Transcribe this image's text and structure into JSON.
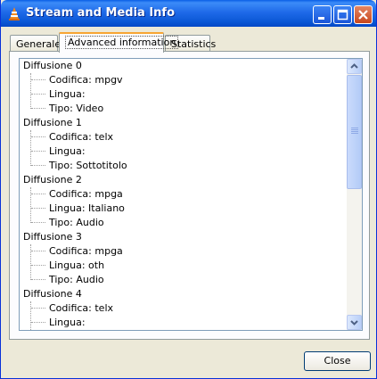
{
  "window": {
    "title": "Stream and Media Info"
  },
  "tabs": [
    {
      "label": "Generale"
    },
    {
      "label": "Advanced information"
    },
    {
      "label": "Statistics"
    }
  ],
  "streams": [
    {
      "label": "Diffusione 0",
      "children": [
        "Codifica: mpgv",
        "Lingua:",
        "Tipo: Video"
      ]
    },
    {
      "label": "Diffusione 1",
      "children": [
        "Codifica: telx",
        "Lingua:",
        "Tipo: Sottotitolo"
      ]
    },
    {
      "label": "Diffusione 2",
      "children": [
        "Codifica: mpga",
        "Lingua: Italiano",
        "Tipo: Audio"
      ]
    },
    {
      "label": "Diffusione 3",
      "children": [
        "Codifica: mpga",
        "Lingua: oth",
        "Tipo: Audio"
      ]
    },
    {
      "label": "Diffusione 4",
      "children": [
        "Codifica: telx",
        "Lingua:"
      ]
    }
  ],
  "buttons": {
    "close": "Close"
  },
  "icons": {
    "app": "vlc-cone-icon",
    "minimize": "minimize-icon",
    "maximize": "maximize-icon",
    "close": "close-icon"
  }
}
